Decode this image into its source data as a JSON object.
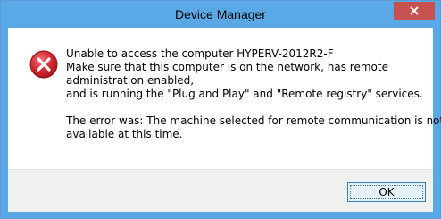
{
  "window": {
    "title": "Device Manager",
    "close_glyph": "×"
  },
  "icon": {
    "name": "error-icon",
    "color": "#c6262e"
  },
  "message": {
    "lines": [
      "Unable to access the computer HYPERV-2012R2-F",
      "Make sure that this computer is on the network, has remote",
      "administration enabled,",
      "and is running the \"Plug and Play\" and \"Remote registry\" services."
    ],
    "error_lines": [
      "The error was: The machine selected for remote communication is not",
      "available at this time."
    ]
  },
  "buttons": {
    "ok_label": "OK"
  },
  "colors": {
    "titlebar": "#5aa9e6",
    "close_button": "#c75050",
    "footer": "#f0f0f0",
    "ok_button_border": "#3c7fb1"
  }
}
